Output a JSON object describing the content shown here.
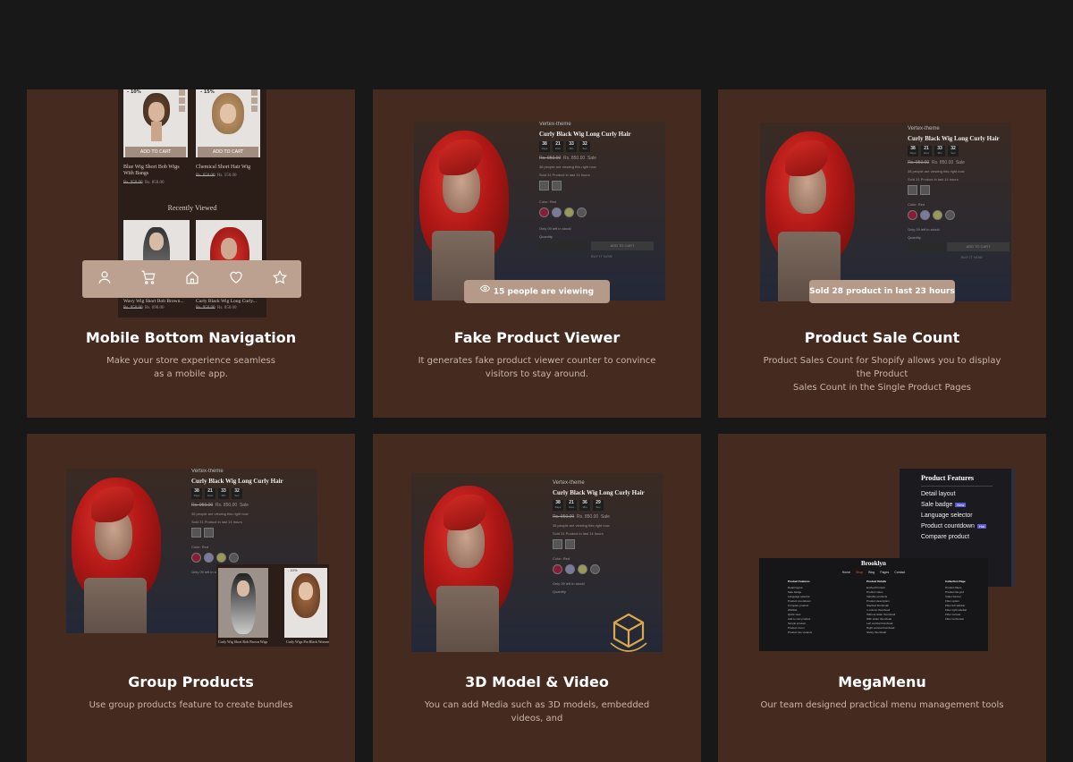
{
  "cards": [
    {
      "title": "Mobile Bottom Navigation",
      "desc_line1": "Make your store experience seamless",
      "desc_line2": "as a mobile app."
    },
    {
      "title": "Fake Product Viewer",
      "desc_line1": "It generates fake product viewer counter to convince",
      "desc_line2": "visitors to stay around."
    },
    {
      "title": "Product Sale Count",
      "desc_line1": "Product Sales Count for Shopify allows you to display the Product",
      "desc_line2": "Sales Count in the  Single Product Pages"
    },
    {
      "title": "Group Products",
      "desc_line1": "Use group products feature to create bundles",
      "desc_line2": ""
    },
    {
      "title": "3D Model & Video",
      "desc_line1": "You can add Media such as 3D models, embedded videos, and",
      "desc_line2": ""
    },
    {
      "title": "MegaMenu",
      "desc_line1": "Our team designed practical menu management tools",
      "desc_line2": ""
    }
  ],
  "mobile": {
    "discount1": "- 10%",
    "discount2": "- 15%",
    "add_to_cart": "ADD TO CART",
    "product1": "Blue Wig Short Bob Wigs With Bangs",
    "product1_old": "Rs. 950.00",
    "product1_new": "Rs. 850.00",
    "product2": "Chemical Short Hair Wig",
    "product2_old": "Rs. 650.00",
    "product2_new": "Rs. 550.00",
    "recently_viewed": "Recently Viewed",
    "product3": "Wavy Wig Short Bob Brown...",
    "product3_old": "Rs. 950.00",
    "product3_new": "Rs. 698.00",
    "product4": "Curly Black Wig Long Curly...",
    "product4_old": "Rs. 950.00",
    "product4_new": "Rs. 850.00",
    "nav_icons": [
      "user-icon",
      "cart-icon",
      "home-icon",
      "heart-icon",
      "star-icon"
    ]
  },
  "product": {
    "vendor": "Vertex-theme",
    "title": "Curly Black Wig Long Curly Hair",
    "timer": [
      {
        "v": "38",
        "u": "Days"
      },
      {
        "v": "21",
        "u": "Hour"
      },
      {
        "v": "33",
        "u": "Min"
      },
      {
        "v": "32",
        "u": "Sec"
      }
    ],
    "timer_b": [
      {
        "v": "38",
        "u": "Days"
      },
      {
        "v": "21",
        "u": "Hour"
      },
      {
        "v": "36",
        "u": "Min"
      },
      {
        "v": "29",
        "u": "Sec"
      }
    ],
    "old_price": "Rs. 950.00",
    "new_price": "Rs. 850.00",
    "sale": "Sale",
    "viewing": "38 people are viewing this right now",
    "sold": "Sold 31 Product in last 14 hours",
    "color_label": "Color: Red",
    "stock": "Only 09 left in stock!",
    "quantity": "Quantity",
    "add_to_cart": "ADD TO CART",
    "buy_now": "BUY IT NOW"
  },
  "pills": {
    "viewer": "15 people are viewing",
    "sale_count": "Sold 28 product in last 23 hours"
  },
  "group": {
    "tag": "- 10%",
    "item1": "Curly Wig Short Bob Brown Wigs",
    "item2": "Curly Wigs Pin Black Women Black"
  },
  "megamenu": {
    "heading": "Product Features",
    "items": [
      "Detail layout",
      "Sale badge",
      "Language selector",
      "Product countdown",
      "Compare product"
    ],
    "badges": {
      "sale": "New",
      "countdown": "Hot"
    },
    "brand": "Brooklyn",
    "nav": [
      "Home",
      "Shop",
      "Blog",
      "Pages",
      "Contact"
    ],
    "cols": [
      {
        "h": "Product Features",
        "items": [
          "Detail layout",
          "Sale badge",
          "Language selector",
          "Product countdown",
          "Compare product",
          "Wishlist",
          "Quick view",
          "Add to cart product",
          "Simple product",
          "Product zoom",
          "Product two variants"
        ]
      },
      {
        "h": "Product Details",
        "items": [
          "Embed Product",
          "Product video",
          "Variable products",
          "Product description",
          "Stacked thumbnail",
          "1 column thumbnail",
          "Without slider thumbnail",
          "With slider thumbnail",
          "Left vertical thumbnail",
          "Right vertical thumbnail",
          "Sticky thumbnail"
        ]
      },
      {
        "h": "Collection Page",
        "items": [
          "Product filters",
          "Product list grid",
          "Video banner",
          "Filter option",
          "Filter left sidebar",
          "Filter right sidebar",
          "Filter canvas",
          "Filter horizontal"
        ]
      }
    ]
  },
  "colors": {
    "card_bg": "#452a20",
    "page_bg": "#181818",
    "pill": "#b59a8a",
    "navbar": "#bca090"
  }
}
